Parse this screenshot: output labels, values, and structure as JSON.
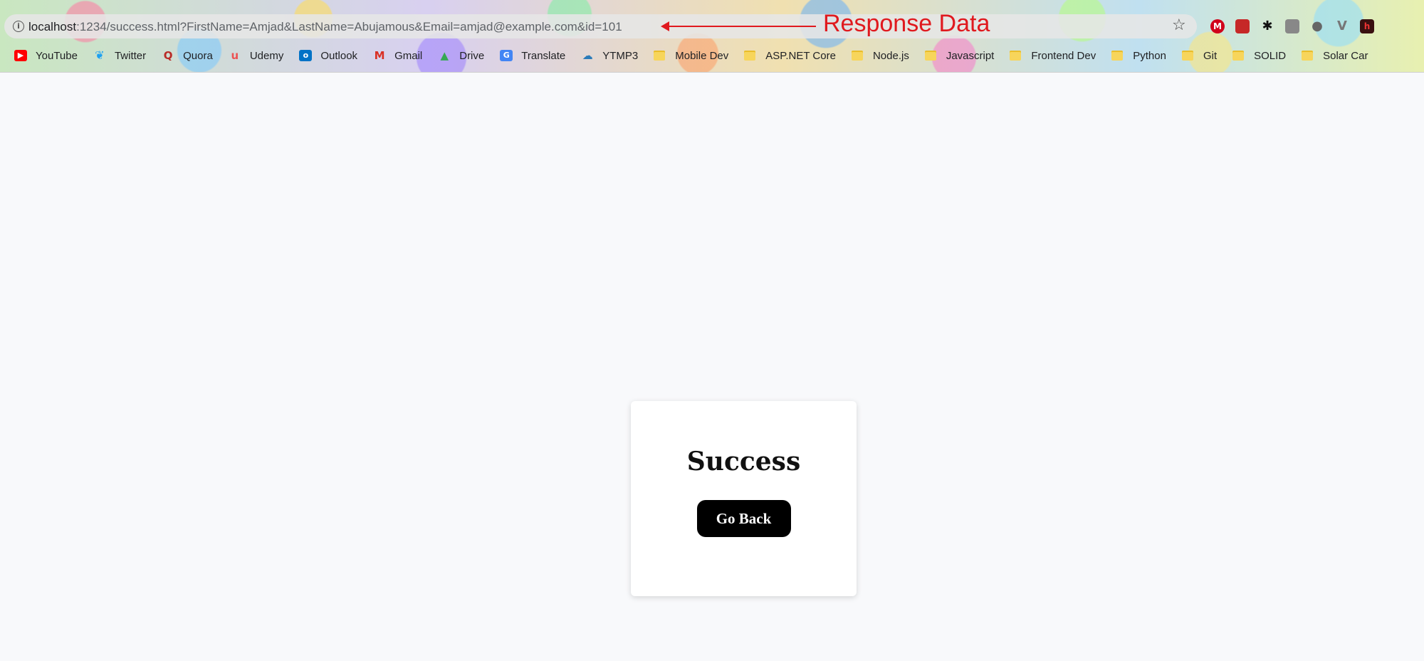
{
  "browser": {
    "url_host": "localhost",
    "url_rest": ":1234/success.html?FirstName=Amjad&LastName=Abujamous&Email=amjad@example.com&id=101",
    "bookmarks": [
      {
        "label": "YouTube",
        "icon": "youtube-icon",
        "color": "#ff0000"
      },
      {
        "label": "Twitter",
        "icon": "twitter-icon",
        "color": "#1da1f2"
      },
      {
        "label": "Quora",
        "icon": "quora-icon",
        "color": "#b92b27"
      },
      {
        "label": "Udemy",
        "icon": "udemy-icon",
        "color": "#ec5252"
      },
      {
        "label": "Outlook",
        "icon": "outlook-icon",
        "color": "#0072c6"
      },
      {
        "label": "Gmail",
        "icon": "gmail-icon",
        "color": "#d93025"
      },
      {
        "label": "Drive",
        "icon": "drive-icon",
        "color": "#34a853"
      },
      {
        "label": "Translate",
        "icon": "translate-icon",
        "color": "#4285f4"
      },
      {
        "label": "YTMP3",
        "icon": "ytmp3-icon",
        "color": "#2b7bb9"
      },
      {
        "label": "Mobile Dev",
        "icon": "folder-icon"
      },
      {
        "label": "ASP.NET Core",
        "icon": "folder-icon"
      },
      {
        "label": "Node.js",
        "icon": "folder-icon"
      },
      {
        "label": "Javascript",
        "icon": "folder-icon"
      },
      {
        "label": "Frontend Dev",
        "icon": "folder-icon"
      },
      {
        "label": "Python",
        "icon": "folder-icon"
      },
      {
        "label": "Git",
        "icon": "folder-icon"
      },
      {
        "label": "SOLID",
        "icon": "folder-icon"
      },
      {
        "label": "Solar Car",
        "icon": "folder-icon"
      }
    ]
  },
  "annotation": {
    "label": "Response Data",
    "color": "#e0191e"
  },
  "page": {
    "title": "Success",
    "button_label": "Go Back"
  }
}
